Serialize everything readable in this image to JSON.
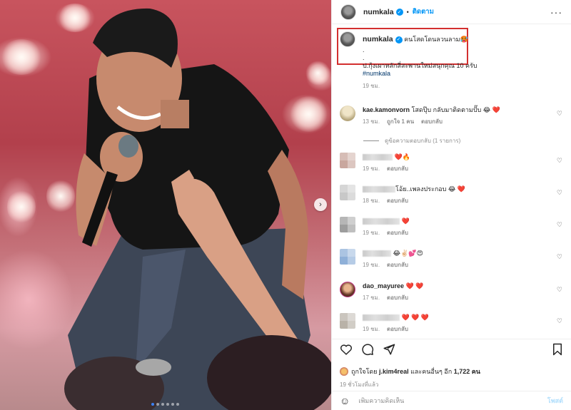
{
  "header": {
    "username": "numkala",
    "separator": "•",
    "follow_label": "ติดตาม",
    "more_icon": "more-horizontal-icon"
  },
  "caption": {
    "username": "numkala",
    "text": "คนโสดโดนลวนลาม🥵",
    "line2": ".",
    "line3": ".",
    "line4": "ป.กุ้งเผาหลักสี่สะพานใหม่สนุกคุณ 10 ครับ",
    "hashtag": "#numkala",
    "time": "19 ชม."
  },
  "comments": [
    {
      "username": "kae.kamonvorn",
      "text": "โสดปุ๊บ กลับมาติดตามปั๊บ 😂 ❤️",
      "time": "13 ชม.",
      "likes": "ถูกใจ 1 คน",
      "reply": "ตอบกลับ"
    },
    {
      "username": "",
      "text": "❤️🔥",
      "time": "19 ชม.",
      "reply": "ตอบกลับ"
    },
    {
      "username": "",
      "text": "โอ้ย..เพลงประกอบ 😂 ❤️",
      "time": "18 ชม.",
      "reply": "ตอบกลับ"
    },
    {
      "username": "",
      "text": "❤️",
      "time": "19 ชม.",
      "reply": "ตอบกลับ"
    },
    {
      "username": "",
      "text": "😂✌🏻💕😍",
      "time": "19 ชม.",
      "reply": "ตอบกลับ"
    },
    {
      "username": "dao_mayuree",
      "text": "❤️ ❤️",
      "time": "17 ชม.",
      "reply": "ตอบกลับ"
    },
    {
      "username": "",
      "text": "❤️ ❤️ ❤️",
      "time": "19 ชม.",
      "reply": "ตอบกลับ"
    }
  ],
  "view_replies": "ดูข้อความตอบกลับ (1 รายการ)",
  "likes": {
    "prefix": "ถูกใจโดย",
    "user": "j.kim4real",
    "suffix": "และคนอื่นๆ อีก",
    "count": "1,722",
    "unit": "คน"
  },
  "time_ago": "19 ชั่วโมงที่แล้ว",
  "add_comment": {
    "placeholder": "เพิ่มความคิดเห็น",
    "post_label": "โพสต์"
  },
  "carousel": {
    "total_dots": 6,
    "active_index": 0
  },
  "colors": {
    "accent": "#0095f6",
    "highlight_border": "#d32f2f",
    "secondary_text": "#8e8e8e"
  }
}
